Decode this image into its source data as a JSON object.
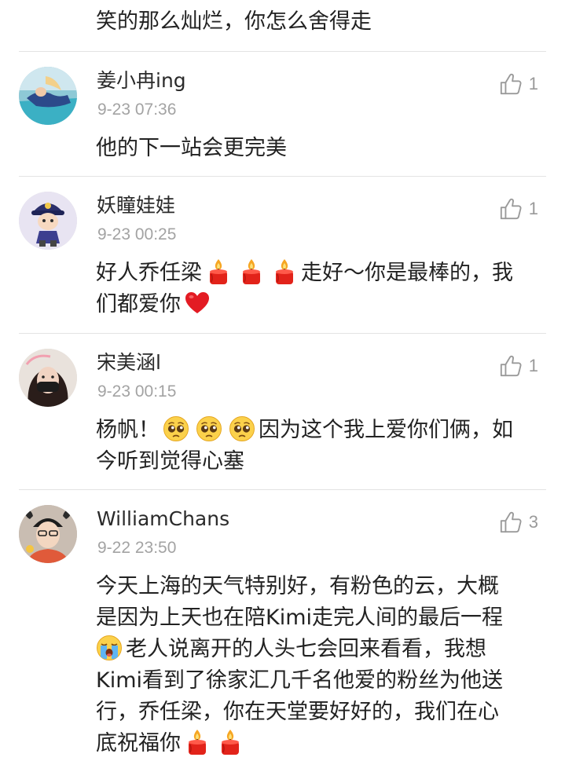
{
  "top_text": "笑的那么灿烂，你怎么舍得走",
  "comments": [
    {
      "username": "姜小冉ing",
      "time": "9-23 07:36",
      "likes": "1",
      "lines": [
        "他的下一站会更完美"
      ]
    },
    {
      "username": "妖瞳娃娃",
      "time": "9-23 00:25",
      "likes": "1",
      "line1_text": "好人乔任梁",
      "line1_after": "走好～你是最棒的，我",
      "line2_text": "们都爱你"
    },
    {
      "username": "宋美涵l",
      "time": "9-23 00:15",
      "likes": "1",
      "line1_text": "杨帆！",
      "line1_after": "因为这个我上爱你们俩，如",
      "line2_text": "今听到觉得心塞"
    },
    {
      "username": "WilliamChans",
      "time": "9-22 23:50",
      "likes": "3",
      "line1": "今天上海的天气特别好，有粉色的云，大概",
      "line2": "是因为上天也在陪Kimi走完人间的最后一程",
      "line3": "老人说离开的人头七会回来看看，我想",
      "line4": "Kimi看到了徐家汇几千名他爱的粉丝为他送",
      "line5": "行，乔任梁，你在天堂要好好的，我们在心",
      "line6": "底祝福你"
    }
  ],
  "icons": {
    "like": "thumbs-up-icon",
    "candle": "candle-emoji",
    "heart": "red-heart-emoji",
    "pleading": "pleading-face-emoji",
    "crying": "loudly-crying-face-emoji"
  },
  "colors": {
    "text": "#222222",
    "meta": "#a3a3a3",
    "divider": "#e3e3e3",
    "icon": "#9a9a9a"
  }
}
